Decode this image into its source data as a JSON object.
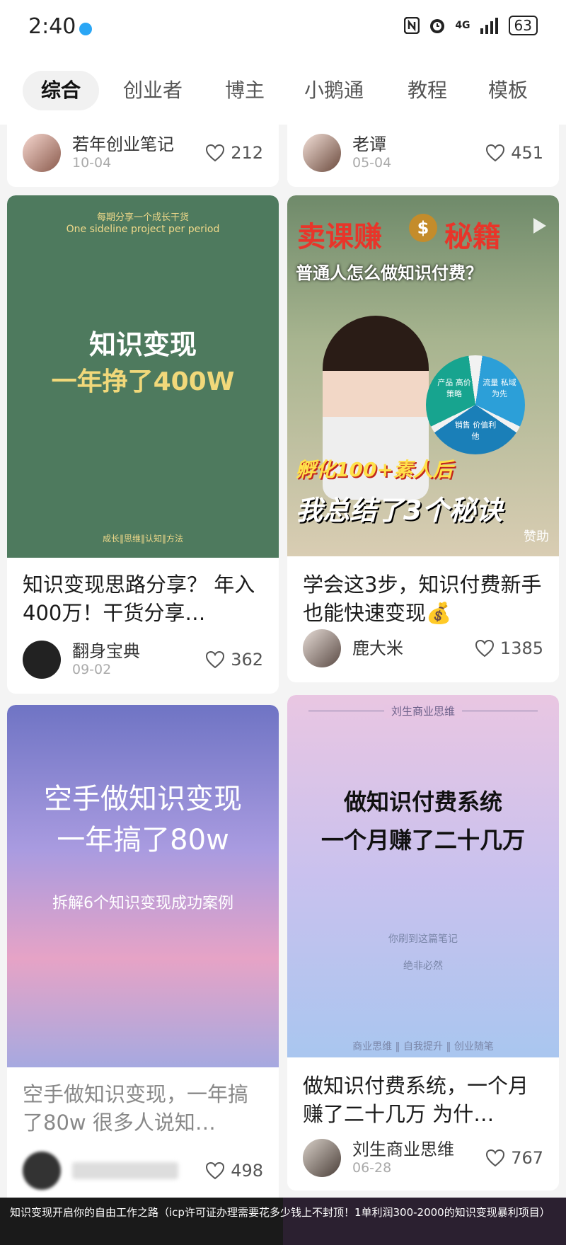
{
  "status": {
    "time": "2:40",
    "icons": [
      "nfc-icon",
      "alarm-icon",
      "signal-icon"
    ],
    "network": "4G",
    "battery": "63"
  },
  "tabs": [
    "综合",
    "创业者",
    "博主",
    "小鹅通",
    "教程",
    "模板"
  ],
  "cards": {
    "c1": {
      "author": "若年创业笔记",
      "date": "10-04",
      "likes": "212"
    },
    "c2": {
      "author": "老谭",
      "date": "05-04",
      "likes": "451"
    },
    "c3": {
      "cover_top": "每期分享一个成长干货",
      "cover_sub": "One sideline project per period",
      "cover_line1": "知识变现",
      "cover_line2": "一年挣了400W",
      "cover_footer": "成长‖思维‖认知‖方法",
      "title": "知识变现思路分享？ 年入400万！干货分享…",
      "author": "翻身宝典",
      "date": "09-02",
      "likes": "362"
    },
    "c4": {
      "cover_banner1": "卖课赚",
      "cover_banner2": "秘籍",
      "cover_q": "普通人怎么做知识付费？",
      "cover_red": "孵化100+素人后",
      "cover_big": "我总结了3个秘诀",
      "sponsor": "赞助",
      "wheel": [
        "产品 高价策略",
        "流量 私域为先",
        "销售 价值利他"
      ],
      "title": "学会这3步，知识付费新手也能快速变现💰",
      "author": "鹿大米",
      "likes": "1385"
    },
    "c5": {
      "cover_line1": "空手做知识变现",
      "cover_line2": "一年搞了80w",
      "cover_sub": "拆解6个知识变现成功案例",
      "title": "空手做知识变现，一年搞了80w 很多人说知…",
      "likes": "498"
    },
    "c6": {
      "cover_top": "刘生商业思维",
      "cover_line1": "做知识付费系统",
      "cover_line2": "一个月赚了二十几万",
      "cover_faint1": "你刷到这篇笔记",
      "cover_faint2": "绝非必然",
      "cover_footer": "商业思维 ‖ 自我提升 ‖ 创业随笔",
      "title": "做知识付费系统，一个月赚了二十几万 为什…",
      "author": "刘生商业思维",
      "date": "06-28",
      "likes": "767"
    }
  },
  "banner": {
    "text": "知识变现开启你的自由工作之路（icp许可证办理需要花多少钱上不封顶！1单利润300-2000的知识变现暴利项目）"
  }
}
